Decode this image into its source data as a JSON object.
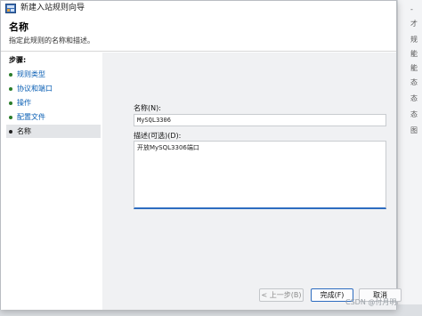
{
  "window": {
    "title": "新建入站规则向导"
  },
  "header": {
    "title": "名称",
    "description": "指定此规则的名称和描述。"
  },
  "steps": {
    "heading": "步骤:",
    "items": [
      {
        "label": "规则类型"
      },
      {
        "label": "协议和端口"
      },
      {
        "label": "操作"
      },
      {
        "label": "配置文件"
      },
      {
        "label": "名称"
      }
    ],
    "current_index": 4
  },
  "form": {
    "name_label": "名称(N):",
    "name_value": "MySQL3306",
    "description_label": "描述(可选)(D):",
    "description_value": "开放MySQL3306端口"
  },
  "buttons": {
    "back": "< 上一步(B)",
    "finish": "完成(F)",
    "cancel": "取消"
  },
  "watermark": "CSDN @付月明",
  "colors": {
    "link": "#0a5fb4",
    "focus_border": "#2d6cc0"
  }
}
